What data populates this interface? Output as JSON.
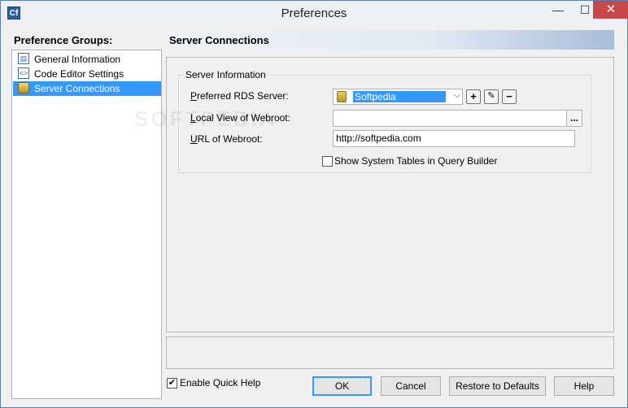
{
  "window": {
    "title": "Preferences",
    "app_icon": "Cf",
    "minimize": "—",
    "maximize": "☐",
    "close": "✕"
  },
  "sidebar": {
    "title": "Preference Groups:",
    "items": [
      {
        "label": "General Information",
        "icon": "general-info-icon"
      },
      {
        "label": "Code Editor Settings",
        "icon": "code-editor-icon"
      },
      {
        "label": "Server Connections",
        "icon": "server-connections-icon",
        "selected": true
      }
    ]
  },
  "section": {
    "title": "Server Connections"
  },
  "server_info": {
    "group_title": "Server Information",
    "rds_label_prefix": "",
    "rds_label_u": "P",
    "rds_label_rest": "referred RDS Server:",
    "rds_value": "Softpedia",
    "add_label": "+",
    "edit_label": "✎",
    "remove_label": "−",
    "local_label_u": "L",
    "local_label_rest": "ocal View of Webroot:",
    "local_value": "",
    "browse_label": "...",
    "url_label_u": "U",
    "url_label_rest": "RL of Webroot:",
    "url_value": "http://softpedia.com",
    "show_tables_label": "Show System Tables in Query Builder",
    "show_tables_checked": false
  },
  "footer": {
    "quick_help_label": "Enable Quick Help",
    "quick_help_checked": true,
    "ok_label": "OK",
    "cancel_label": "Cancel",
    "restore_label": "Restore to Defaults",
    "help_label": "Help"
  },
  "watermark": "SOFTPEDIA"
}
